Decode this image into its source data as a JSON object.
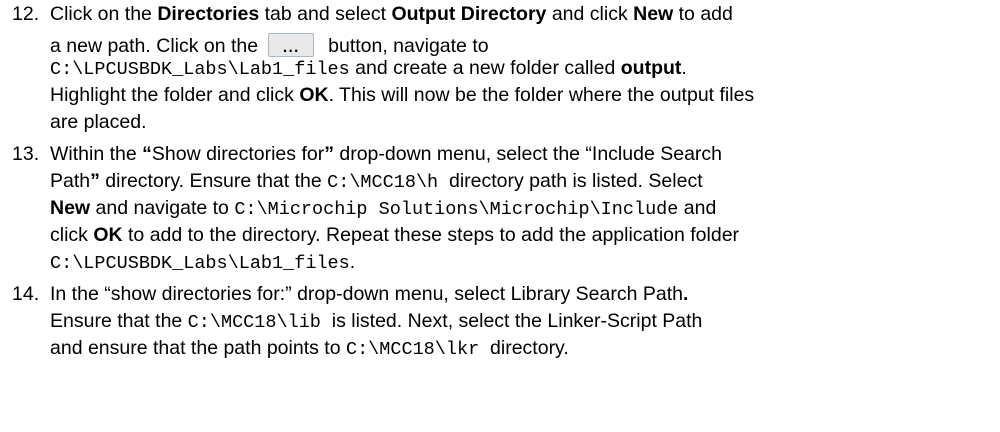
{
  "step12": {
    "num": "12.",
    "l1a": "Click on the ",
    "l1b": "Directories",
    "l1c": " tab and select ",
    "l1d": "Output Directory",
    "l1e": " and click ",
    "l1f": "New",
    "l1g": " to add",
    "l2a": "a new path. Click on the",
    "button_label": "...",
    "l2b": "button, navigate to",
    "l3a": "C:\\LPCUSBDK_Labs\\Lab1_files",
    "l3b": " and create a new folder called ",
    "l3c": "output",
    "l3d": ".",
    "l4a": "Highlight the folder and click ",
    "l4b": "OK",
    "l4c": ". This will now be the folder where the output files",
    "l5": "are placed."
  },
  "step13": {
    "num": "13.",
    "l1a": "Within the ",
    "l1b": "“",
    "l1c": "Show directories for",
    "l1d": "”",
    "l1e": " drop-down menu, select the “Include Search",
    "l2a": "Path",
    "l2b": "”",
    "l2c": " directory. Ensure that the ",
    "l2d": "C:\\MCC18\\h",
    "l2e": "  directory path is listed. Select",
    "l3a": "New",
    "l3b": " and navigate to ",
    "l3c": "C:\\Microchip Solutions\\Microchip\\Include",
    "l3d": " and",
    "l4a": "click ",
    "l4b": "OK",
    "l4c": " to add to the directory. Repeat these steps to add the application folder",
    "l5": "C:\\LPCUSBDK_Labs\\Lab1_files",
    "l5b": "."
  },
  "step14": {
    "num": "14.",
    "l1a": "In the “show directories for:” drop-down menu, select Library Search Path",
    "l1b": ".",
    "l2a": "Ensure that the ",
    "l2b": "C:\\MCC18\\lib",
    "l2c": "  is listed",
    "l2d": ". Next, select the Linker-Script Path",
    "l3a": "and ensure that the path points to ",
    "l3b": "C:\\MCC18\\lkr",
    "l3c": "  directory."
  }
}
